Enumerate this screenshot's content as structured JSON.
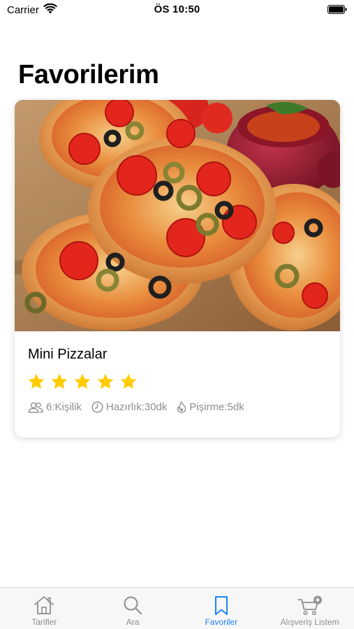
{
  "status_bar": {
    "carrier": "Carrier",
    "time": "ÖS 10:50"
  },
  "page": {
    "title": "Favorilerim"
  },
  "favorites": [
    {
      "name": "Mini Pizzalar",
      "rating": 5,
      "rating_max": 5,
      "servings": "6:Kişilik",
      "prep": "Hazırlık:30dk",
      "cook": "Pişirme:5dk",
      "image": "mini-pizzas-photo"
    }
  ],
  "tab_bar": {
    "tabs": [
      {
        "label": "Tarifler",
        "icon": "house-icon"
      },
      {
        "label": "Ara",
        "icon": "search-icon"
      },
      {
        "label": "Favoriler",
        "icon": "bookmark-icon"
      },
      {
        "label": "Alışveriş Listem",
        "icon": "cart-plus-icon"
      }
    ],
    "active_index": 2
  },
  "colors": {
    "accent": "#1a82f7",
    "star": "#ffcc00",
    "meta_text": "#8e8e93"
  }
}
